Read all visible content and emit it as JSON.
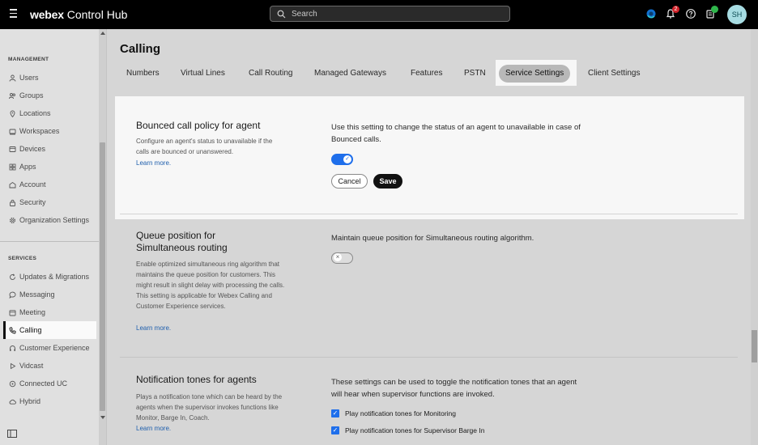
{
  "topbar": {
    "brand_bold": "webex",
    "brand_rest": " Control Hub",
    "search_placeholder": "Search",
    "notification_count": "2",
    "avatar_initials": "SH"
  },
  "sidebar": {
    "management_header": "MANAGEMENT",
    "management_items": [
      {
        "label": "Users",
        "icon": "person-icon"
      },
      {
        "label": "Groups",
        "icon": "group-icon"
      },
      {
        "label": "Locations",
        "icon": "location-pin-icon"
      },
      {
        "label": "Workspaces",
        "icon": "workspace-icon"
      },
      {
        "label": "Devices",
        "icon": "device-icon"
      },
      {
        "label": "Apps",
        "icon": "apps-icon"
      },
      {
        "label": "Account",
        "icon": "account-icon"
      },
      {
        "label": "Security",
        "icon": "lock-icon"
      },
      {
        "label": "Organization Settings",
        "icon": "gear-icon"
      }
    ],
    "services_header": "SERVICES",
    "services_items": [
      {
        "label": "Updates & Migrations",
        "icon": "refresh-icon"
      },
      {
        "label": "Messaging",
        "icon": "chat-icon"
      },
      {
        "label": "Meeting",
        "icon": "calendar-icon"
      },
      {
        "label": "Calling",
        "icon": "phone-icon"
      },
      {
        "label": "Customer Experience",
        "icon": "customer-icon"
      },
      {
        "label": "Vidcast",
        "icon": "play-icon"
      },
      {
        "label": "Connected UC",
        "icon": "connected-icon"
      },
      {
        "label": "Hybrid",
        "icon": "cloud-icon"
      }
    ],
    "active_item": "Calling"
  },
  "main": {
    "page_title": "Calling",
    "tabs": [
      {
        "label": "Numbers"
      },
      {
        "label": "Virtual Lines"
      },
      {
        "label": "Call Routing"
      },
      {
        "label": "Managed Gateways"
      },
      {
        "label": "Features"
      },
      {
        "label": "PSTN"
      },
      {
        "label": "Service Settings"
      },
      {
        "label": "Client Settings"
      }
    ],
    "active_tab": "Service Settings",
    "bounced": {
      "title": "Bounced call policy for agent",
      "description": "Configure an agent's status to unavailable if the calls are bounced or unanswered.",
      "learn_more": "Learn more.",
      "right_text": "Use this setting to change the status of an agent to unavailable in case of Bounced calls.",
      "toggle_on": true,
      "cancel_label": "Cancel",
      "save_label": "Save"
    },
    "queue": {
      "title_line1": "Queue position for",
      "title_line2": "Simultaneous routing",
      "description": "Enable optimized simultaneous ring algorithm that maintains the queue position for customers. This might result in slight delay with processing the calls. This setting is applicable for Webex Calling and Customer Experience services.",
      "learn_more": "Learn more.",
      "right_text": "Maintain queue position for Simultaneous routing algorithm.",
      "toggle_on": false
    },
    "notification": {
      "title": "Notification tones for agents",
      "description": "Plays a notification tone which can be heard by the agents when the supervisor invokes functions like Monitor, Barge In, Coach.",
      "learn_more": "Learn more.",
      "right_text": "These settings can be used to toggle the notification tones that an agent will hear when supervisor functions are invoked.",
      "options": [
        {
          "label": "Play notification tones for Monitoring",
          "checked": true
        },
        {
          "label": "Play notification tones for Supervisor Barge In",
          "checked": true
        }
      ]
    }
  },
  "colors": {
    "accent_blue": "#1f6feb",
    "active_tab_bg": "#b8b8b8",
    "badge_red": "#d2232a",
    "badge_green": "#2fb64b",
    "avatar_bg": "#a7dce2"
  }
}
